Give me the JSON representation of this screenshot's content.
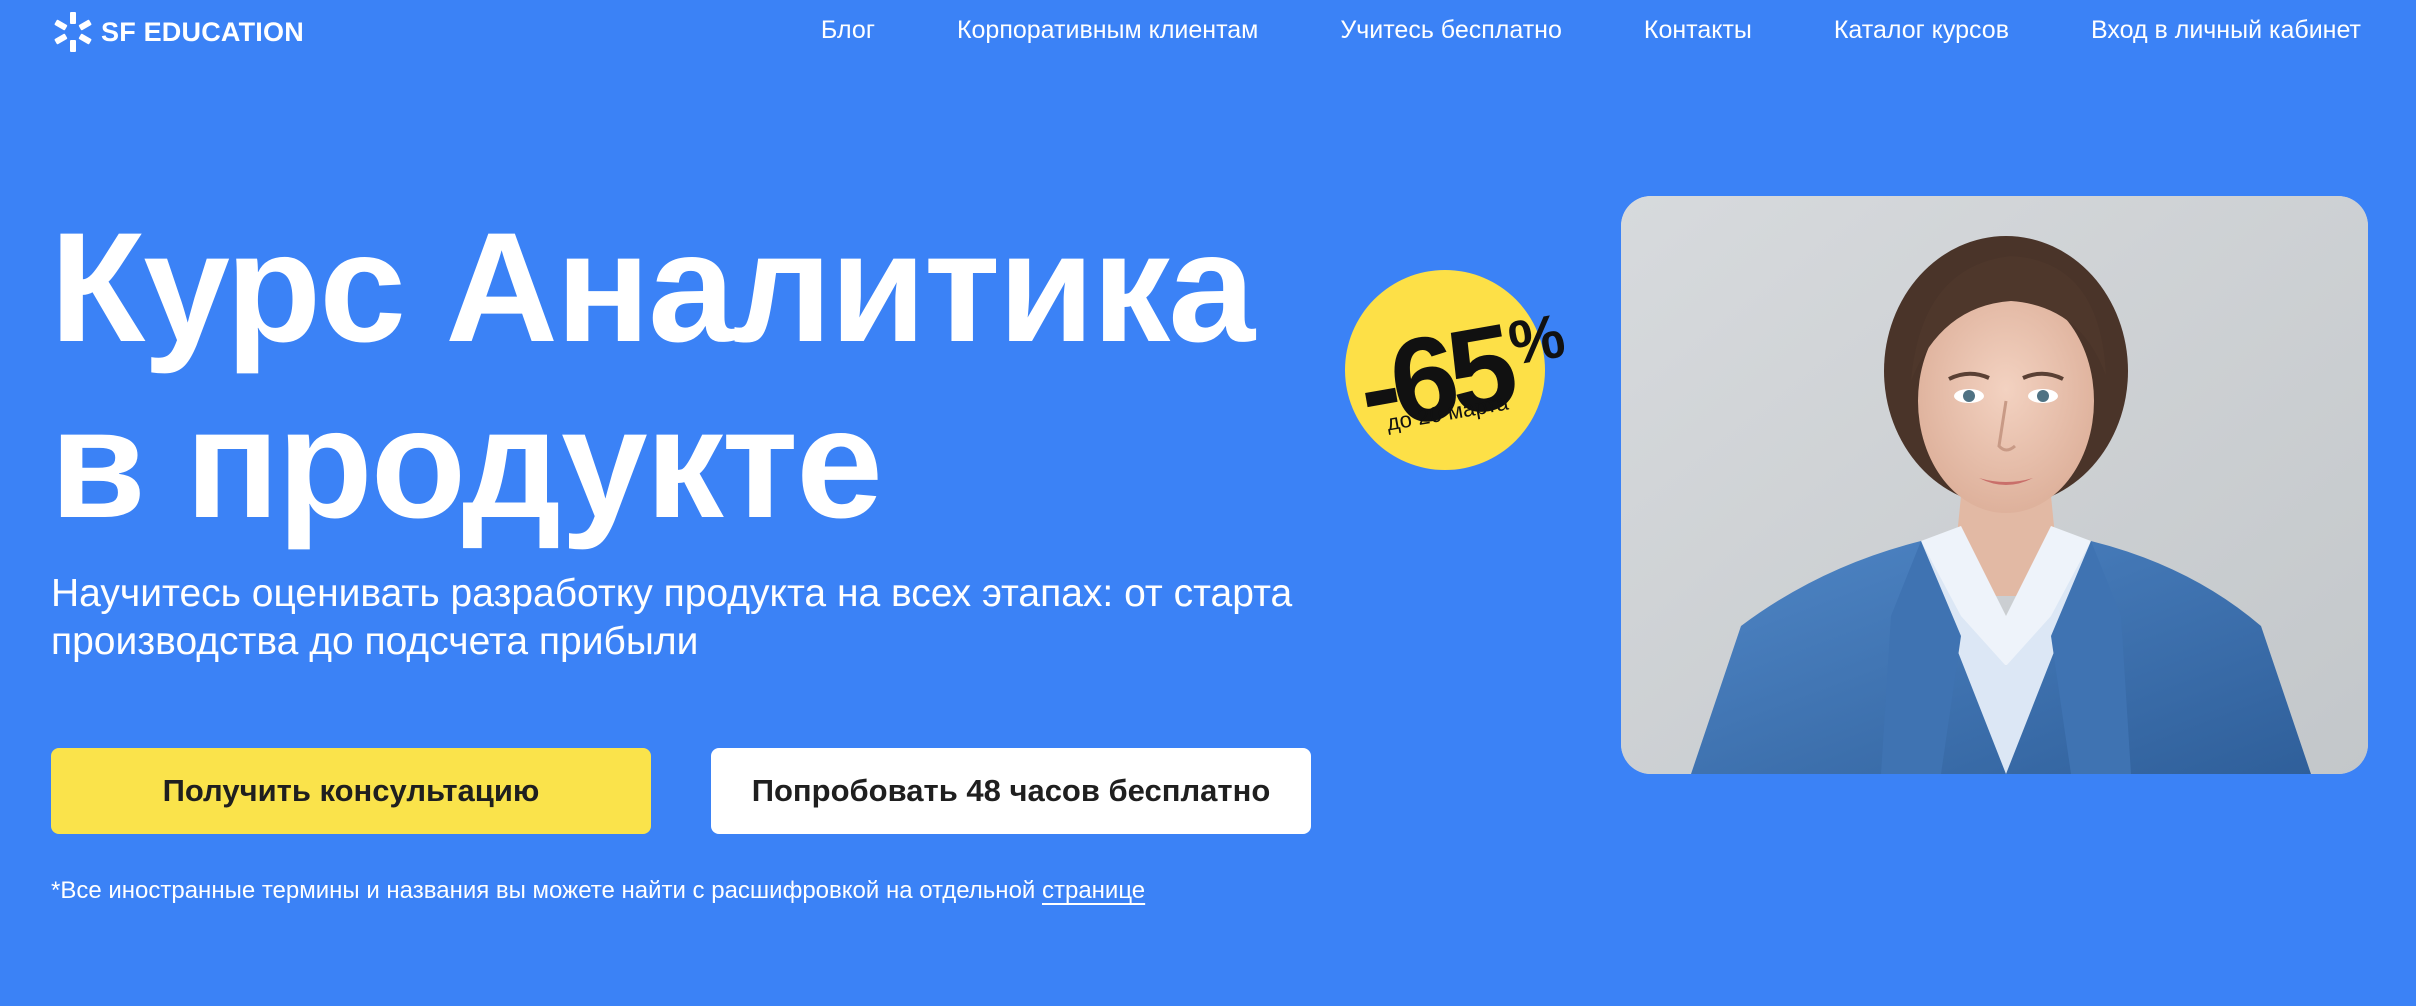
{
  "brand": {
    "name": "SF EDUCATION",
    "logo_icon": "sf-logo-icon"
  },
  "nav": {
    "items": [
      {
        "label": "Блог"
      },
      {
        "label": "Корпоративным клиентам"
      },
      {
        "label": "Учитесь бесплатно"
      },
      {
        "label": "Контакты"
      },
      {
        "label": "Каталог курсов"
      },
      {
        "label": "Вход в личный кабинет"
      }
    ]
  },
  "hero": {
    "title_line1": "Курс Аналитика",
    "title_line2": "в продукте",
    "subtitle_line1": "Научитесь оценивать разработку продукта на всех этапах: от старта",
    "subtitle_line2": "производства до подсчета прибыли",
    "image": "woman-in-blue-blazer-portrait"
  },
  "badge": {
    "value": "-65",
    "percent_sign": "%",
    "date": "до 20 марта"
  },
  "buttons": {
    "primary_label": "Получить консультацию",
    "secondary_label": "Попробовать 48 часов бесплатно"
  },
  "footnote": {
    "text": "*Все иностранные термины и названия вы можете найти с расшифровкой на отдельной ",
    "link_label": "странице"
  },
  "colors": {
    "background": "#3b82f6",
    "accent_yellow": "#fae34b",
    "text": "#ffffff",
    "button_text": "#1f1f1f"
  }
}
